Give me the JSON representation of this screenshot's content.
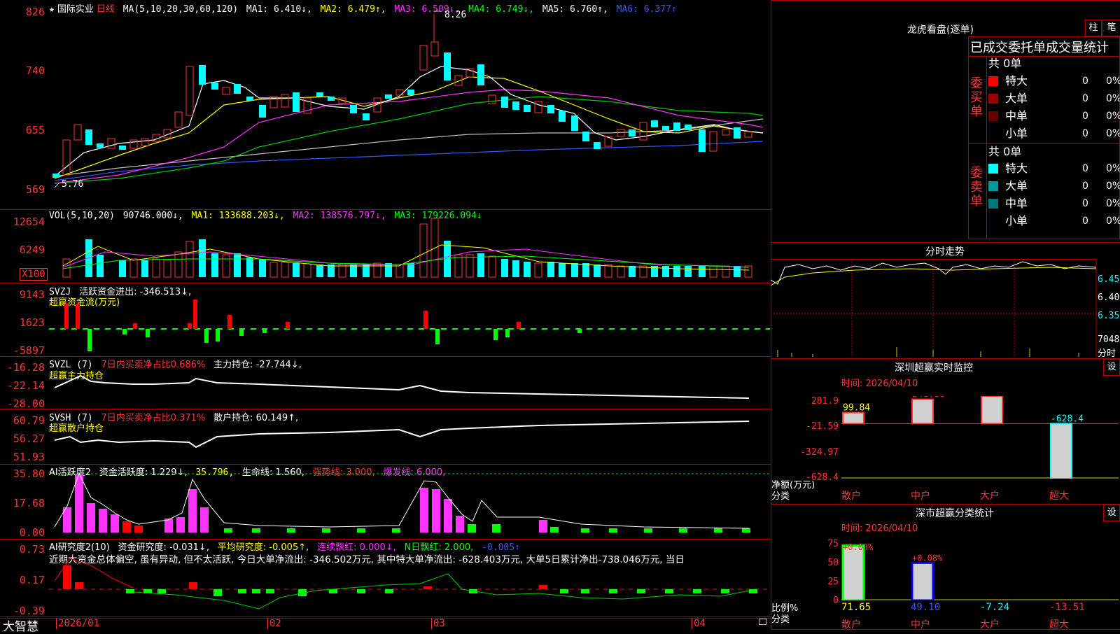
{
  "stock": {
    "name": "国际实业",
    "period": "日线",
    "ma_header": "MA(5,10,20,30,60,120)",
    "ma1": "MA1: 6.410↓,",
    "ma2": "MA2: 6.479↑,",
    "ma3": "MA3: 6.509↓,",
    "ma4": "MA4: 6.749↓,",
    "ma5": "MA5: 6.760↑,",
    "ma6": "MA6: 6.377↑",
    "high_mark": "8.26",
    "low_mark": "5.76",
    "star": "★"
  },
  "price_axis": [
    "826",
    "740",
    "655",
    "569"
  ],
  "vol": {
    "header": "VOL(5,10,20)",
    "value": "90746.000↓,",
    "ma1": "MA1: 133688.203↓,",
    "ma2": "MA2: 138576.797↓,",
    "ma3": "MA3: 179226.094↓",
    "axis": [
      "12654",
      "6249"
    ],
    "unit": "X100"
  },
  "svzj": {
    "header": "SVZJ",
    "label": "活跃资金进出: -346.513↓,",
    "subtitle": "超赢资金流(万元)",
    "axis": [
      "9143",
      "1623",
      "-5897"
    ]
  },
  "svzl": {
    "header": "SVZL (7)",
    "ratio": "7日内买卖净占比0.686%",
    "main": "主力持仓: -27.744↓,",
    "subtitle": "超赢主力持仓",
    "axis": [
      "-16.28",
      "-22.14",
      "-28.00"
    ]
  },
  "svsh": {
    "header": "SVSH (7)",
    "ratio": "7日内买卖净占比0.371%",
    "retail": "散户持仓: 60.149↑,",
    "subtitle": "超赢散户持仓",
    "axis": [
      "60.79",
      "56.27",
      "51.93"
    ]
  },
  "ai_active": {
    "header": "AI活跃度2",
    "v1": "资金活跃度: 1.229↓,",
    "v2": "35.796,",
    "v3": "生命线: 1.560,",
    "v4": "强势线: 3.000,",
    "v5": "爆发线: 6.000,",
    "axis": [
      "35.80",
      "17.68",
      "0.00"
    ]
  },
  "ai_research": {
    "header": "AI研究度2(10)",
    "v1": "资金研究度: -0.031↓,",
    "v2": "平均研究度: -0.005↑,",
    "v3": "连续飘红: 0.000↓,",
    "v4": "N日飘红: 2.000,",
    "v5": "-0.005↑",
    "summary": "近期大资金总体偏空, 虽有异动, 但不太活跃, 今日大单净流出: -346.502万元, 其中特大单净流出: -628.403万元, 大单5日累计净出-738.046万元, 当日",
    "axis": [
      "0.73",
      "0.17",
      "-0.39"
    ]
  },
  "date_axis": [
    "2026/01",
    "02",
    "03",
    "04"
  ],
  "brand": "大智慧",
  "right": {
    "dragon_title": "龙虎看盘(逐单)",
    "btn_zhu": "柱",
    "btn_bi": "笔",
    "order_title": "已成交委托单成交量统计",
    "buy_label": "委买单",
    "sell_label": "委卖单",
    "buy_total": "共 0单",
    "sell_total": "共 0单",
    "buy_rows": [
      {
        "label": "特大",
        "count": "0",
        "pct": "0%",
        "color": "#ff0000"
      },
      {
        "label": "大单",
        "count": "0",
        "pct": "0%",
        "color": "#990000"
      },
      {
        "label": "中单",
        "count": "0",
        "pct": "0%",
        "color": "#660000"
      },
      {
        "label": "小单",
        "count": "0",
        "pct": "0%",
        "color": "#000000"
      }
    ],
    "sell_rows": [
      {
        "label": "特大",
        "count": "0",
        "pct": "0%",
        "color": "#00ffff"
      },
      {
        "label": "大单",
        "count": "0",
        "pct": "0%",
        "color": "#009999"
      },
      {
        "label": "中单",
        "count": "0",
        "pct": "0%",
        "color": "#007777"
      },
      {
        "label": "小单",
        "count": "0",
        "pct": "0%",
        "color": "#000000"
      }
    ],
    "intraday_title": "分时走势",
    "intraday_axis": [
      "6.45",
      "6.40",
      "6.35"
    ],
    "intraday_vol_label": "7048",
    "intraday_vol_unit": "分时",
    "sz_monitor_title": "深圳超赢实时监控",
    "sz_monitor_time": "时间: 2026/04/10",
    "settings_label": "设",
    "monitor_axis": [
      "281.9",
      "-21.59",
      "-324.97",
      "-628.4"
    ],
    "monitor_ylabel": "净额(万元)",
    "monitor_xlabel": "分类",
    "cls_title": "深市超赢分类统计",
    "cls_time": "时间: 2026/04/10",
    "cls_axis": [
      "75",
      "50",
      "25",
      "0"
    ],
    "cls_ylabel": "比例%",
    "cls_xlabel": "分类"
  },
  "chart_data": [
    {
      "type": "bar",
      "title": "深圳超赢实时监控",
      "ylabel": "净额(万元)",
      "xlabel": "分类",
      "categories": [
        "散户",
        "中户",
        "大户",
        "超大"
      ],
      "values": [
        99.84,
        246.66,
        281.9,
        -628.4
      ],
      "labels": [
        "99.84",
        "246.66",
        "281.9",
        "-628.4"
      ],
      "ylim": [
        -628.4,
        281.9
      ]
    },
    {
      "type": "bar",
      "title": "深市超赢分类统计",
      "ylabel": "比例%",
      "xlabel": "分类",
      "categories": [
        "散户",
        "中户",
        "大户",
        "超大"
      ],
      "values": [
        71.65,
        49.1,
        -7.24,
        -13.51
      ],
      "top_labels": [
        "+0.03%",
        "+0.08%",
        "",
        ""
      ],
      "ylim": [
        0,
        75
      ]
    }
  ]
}
